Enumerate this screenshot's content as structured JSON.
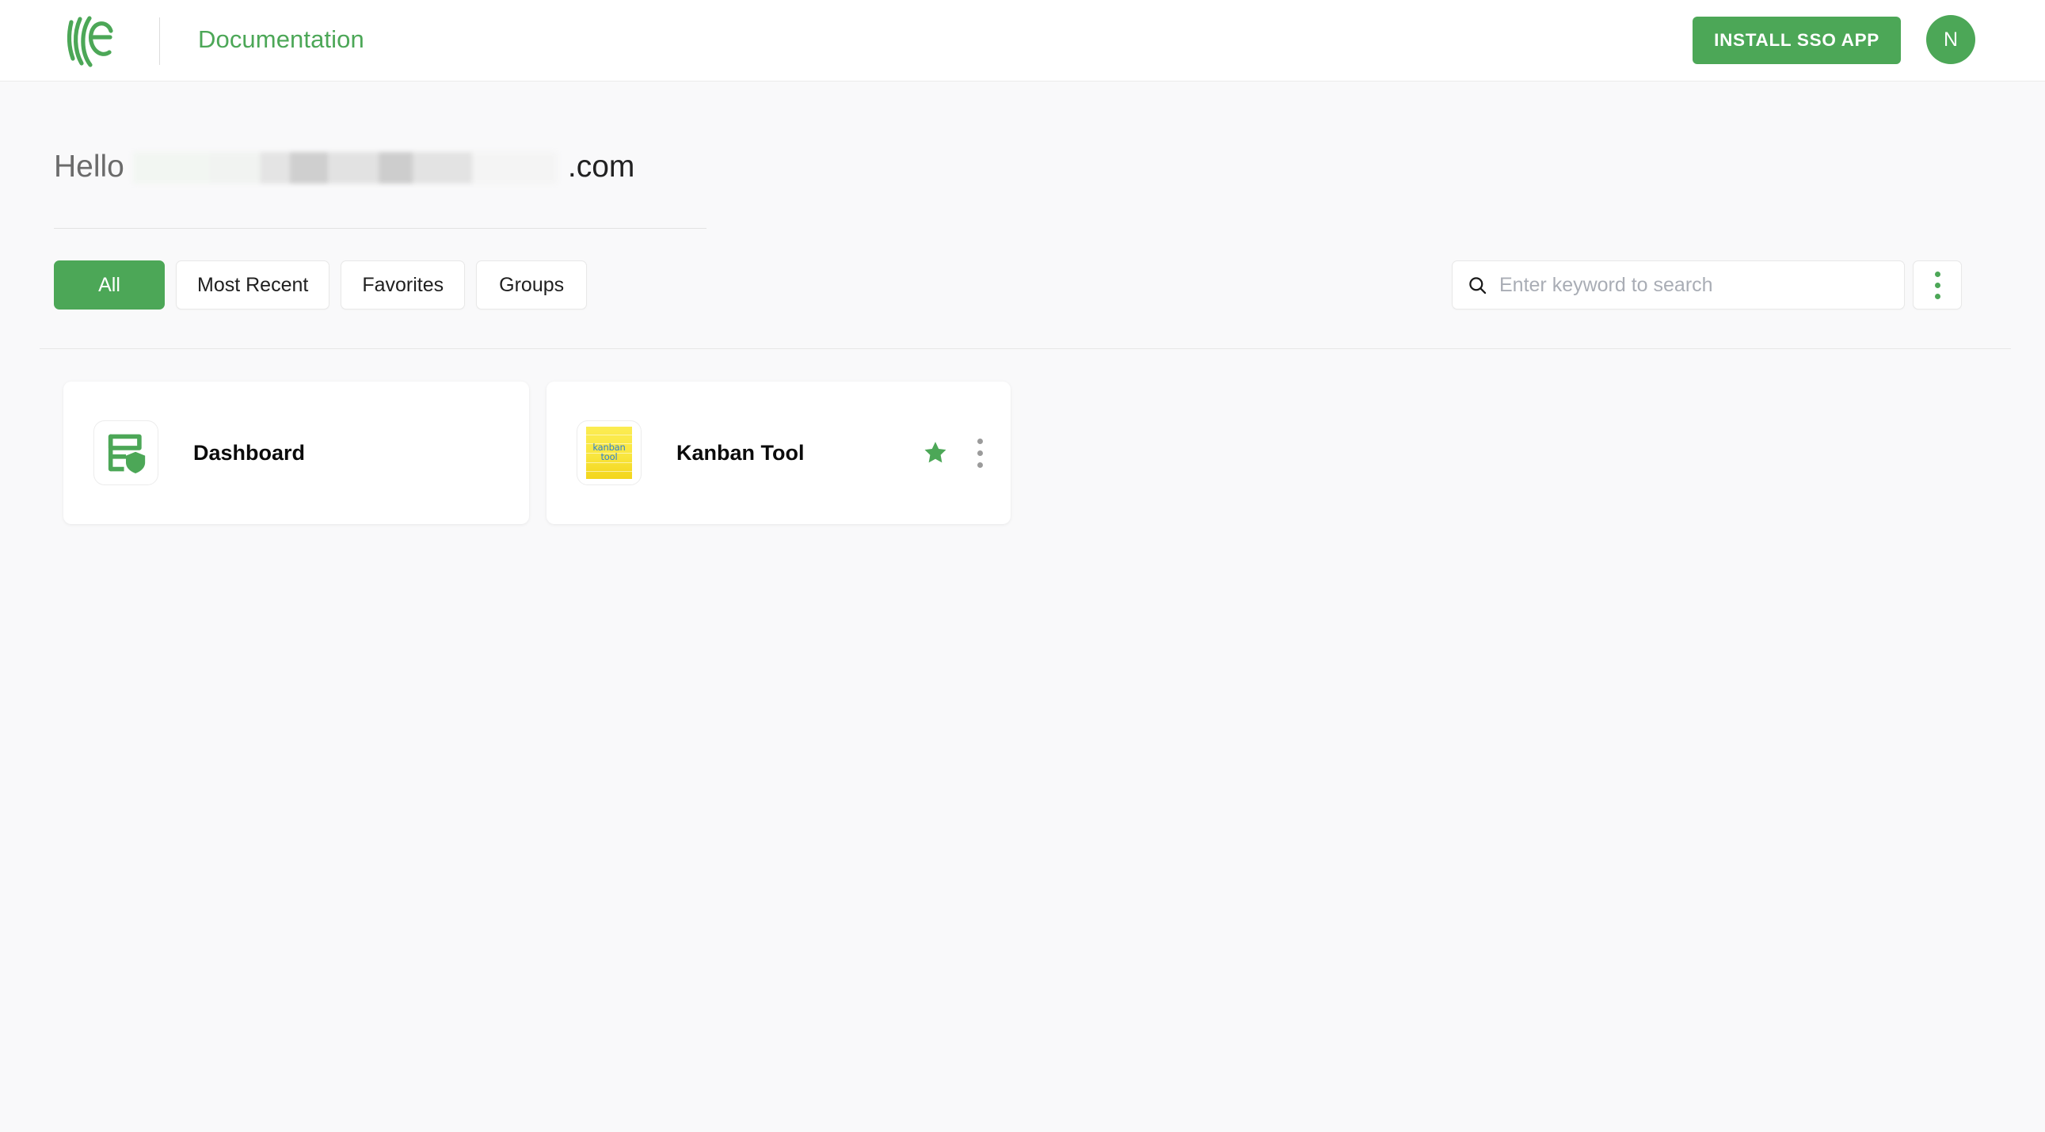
{
  "header": {
    "logo_icon": "nice-brand-logo-icon",
    "title": "Documentation",
    "install_button_label": "INSTALL SSO APP",
    "avatar_initial": "N",
    "brand_color": "#4CA757"
  },
  "greeting": {
    "salutation": "Hello",
    "redacted_name": "",
    "domain_suffix": ".com"
  },
  "filters": {
    "tabs": [
      {
        "label": "All",
        "active": true
      },
      {
        "label": "Most Recent",
        "active": false
      },
      {
        "label": "Favorites",
        "active": false
      },
      {
        "label": "Groups",
        "active": false
      }
    ]
  },
  "search": {
    "placeholder": "Enter keyword to search",
    "value": "",
    "icon": "search-icon"
  },
  "overflow_menu": {
    "icon": "kebab-menu-icon",
    "dot_color": "#4CA757"
  },
  "apps": [
    {
      "name": "Dashboard",
      "icon": "dashboard-shield-icon",
      "icon_color": "#4CA757",
      "favorite": false,
      "has_menu": false
    },
    {
      "name": "Kanban Tool",
      "icon": "kanban-tool-icon",
      "icon_text_line1": "kanban",
      "icon_text_line2": "tool",
      "icon_bg_color": "#F6E13C",
      "icon_text_color": "#2B7FD4",
      "favorite": true,
      "favorite_color": "#4CA757",
      "has_menu": true
    }
  ]
}
